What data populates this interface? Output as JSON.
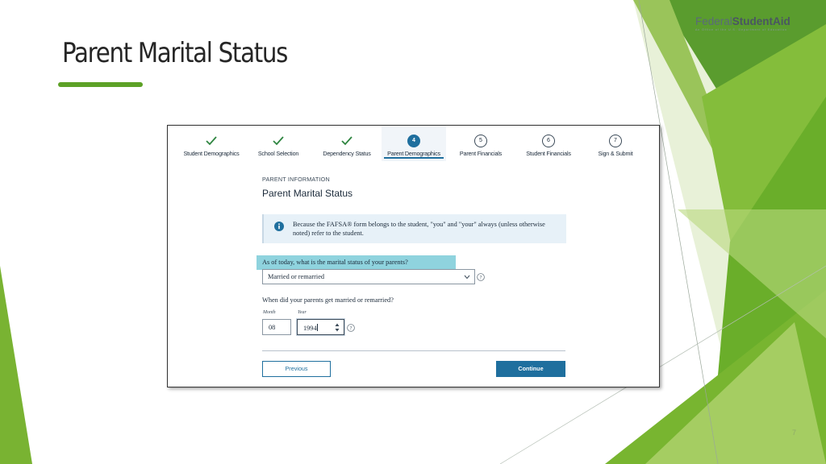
{
  "slide": {
    "title": "Parent Marital Status",
    "page_number": "7",
    "accent_color": "#5da126"
  },
  "logo": {
    "part1": "Federal",
    "part2": "StudentAid",
    "tagline": "An Office of the U.S. Department of Education"
  },
  "stepper": {
    "steps": [
      {
        "label": "Student Demographics",
        "status": "complete",
        "icon": "check-icon"
      },
      {
        "label": "School Selection",
        "status": "complete",
        "icon": "check-icon"
      },
      {
        "label": "Dependency Status",
        "status": "complete",
        "icon": "check-icon"
      },
      {
        "label": "Parent Demographics",
        "status": "current",
        "number": "4"
      },
      {
        "label": "Parent Financials",
        "status": "upcoming",
        "number": "5"
      },
      {
        "label": "Student Financials",
        "status": "upcoming",
        "number": "6"
      },
      {
        "label": "Sign & Submit",
        "status": "upcoming",
        "number": "7"
      }
    ]
  },
  "form": {
    "section": "PARENT INFORMATION",
    "title": "Parent Marital Status",
    "notice": "Because the FAFSA® form belongs to the student, \"you\" and \"your\" always (unless otherwise noted) refer to the student.",
    "marital_question": "As of today, what is the marital status of your parents?",
    "marital_value": "Married or remarried",
    "date_question": "When did your parents get married or remarried?",
    "month_label": "Month",
    "month_value": "08",
    "year_label": "Year",
    "year_value": "1994",
    "previous_label": "Previous",
    "continue_label": "Continue"
  },
  "colors": {
    "primary_blue": "#1f6f9e",
    "highlight": "#8fd3de",
    "notice_bg": "#e7f1f8"
  }
}
